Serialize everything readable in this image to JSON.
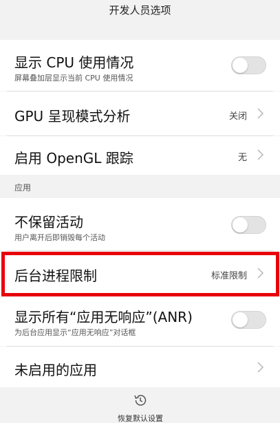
{
  "header": {
    "title": "开发人员选项"
  },
  "settings": [
    {
      "title": "显示 CPU 使用情况",
      "subtitle": "屏幕叠加层显示当前 CPU 使用情况",
      "toggle": "off"
    },
    {
      "title": "GPU 呈现模式分析",
      "value": "关闭"
    },
    {
      "title": "启用 OpenGL 跟踪",
      "value": "无"
    }
  ],
  "section": {
    "label": "应用"
  },
  "apps": [
    {
      "title": "不保留活动",
      "subtitle": "用户离开后即销毁每个活动",
      "toggle": "off"
    },
    {
      "title": "后台进程限制",
      "value": "标准限制",
      "highlighted": true
    },
    {
      "title": "显示所有“应用无响应”(ANR)",
      "subtitle": "为后台应用显示“应用无响应”对话框",
      "toggle": "off"
    },
    {
      "title": "未启用的应用"
    }
  ],
  "footer": {
    "reset_label": "恢复默认设置",
    "icon": "restore-history-icon"
  },
  "colors": {
    "highlight": "#e8000b",
    "background": "#f2f2f2",
    "row": "#ffffff"
  }
}
